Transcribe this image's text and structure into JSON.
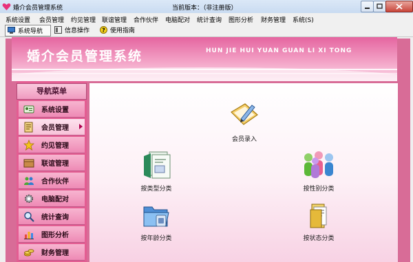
{
  "window": {
    "title": "婚介会员管理系统",
    "version_text": "当前版本：（非注册版）"
  },
  "menubar": {
    "items": [
      "系统设置",
      "会员管理",
      "约见管理",
      "联谊管理",
      "合作伙伴",
      "电脑配对",
      "统计查询",
      "图形分析",
      "财务管理",
      "系统(S)"
    ]
  },
  "toolbar": {
    "buttons": [
      {
        "label": "系统导航",
        "icon": "monitor-icon"
      },
      {
        "label": "信息操作",
        "icon": "panel-icon"
      },
      {
        "label": "使用指南",
        "icon": "help-icon"
      }
    ]
  },
  "banner": {
    "title": "婚介会员管理系统",
    "subtitle": "HUN JIE HUI YUAN GUAN LI XI TONG"
  },
  "nav": {
    "header": "导航菜单",
    "items": [
      {
        "label": "系统设置",
        "icon": "id-card-icon"
      },
      {
        "label": "会员管理",
        "icon": "document-icon",
        "selected": true
      },
      {
        "label": "约见管理",
        "icon": "star-icon"
      },
      {
        "label": "联谊管理",
        "icon": "box-icon"
      },
      {
        "label": "合作伙伴",
        "icon": "people-icon"
      },
      {
        "label": "电脑配对",
        "icon": "gear-icon"
      },
      {
        "label": "统计查询",
        "icon": "magnifier-icon"
      },
      {
        "label": "图形分析",
        "icon": "chart-icon"
      },
      {
        "label": "财务管理",
        "icon": "coins-icon"
      }
    ]
  },
  "content": {
    "tiles": [
      {
        "label": "会员录入",
        "icon": "register-icon"
      },
      {
        "label": "按类型分类",
        "icon": "doc-type-icon"
      },
      {
        "label": "按性别分类",
        "icon": "people-group-icon"
      },
      {
        "label": "按年龄分类",
        "icon": "folder-blue-icon"
      },
      {
        "label": "按状态分类",
        "icon": "folder-yellow-icon"
      }
    ]
  },
  "colors": {
    "banner_pink": "#e565a0",
    "nav_pink": "#ee8ab5",
    "frame_pink": "#d86c97",
    "selected_arrow": "#b0004e"
  }
}
